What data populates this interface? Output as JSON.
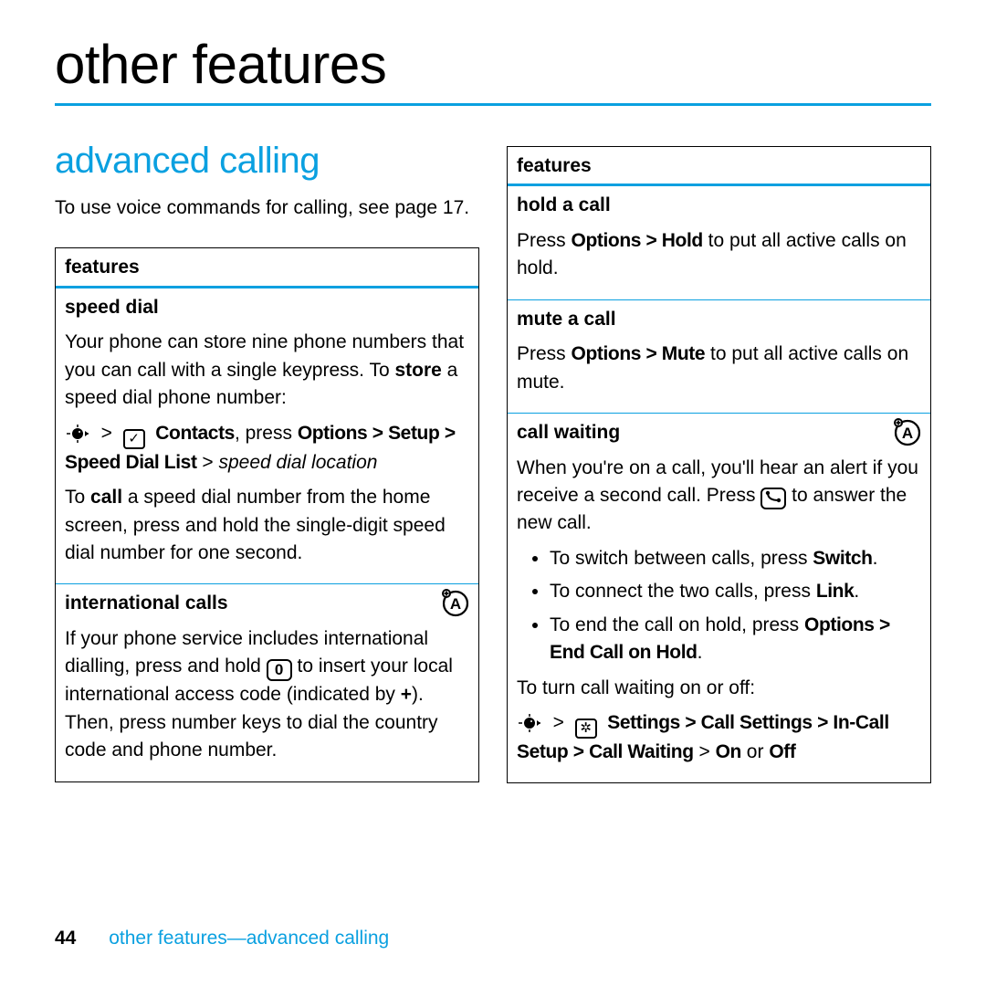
{
  "pageTitle": "other features",
  "sectionTitle": "advanced calling",
  "intro": "To use voice commands for calling, see page 17.",
  "featuresLabel": "features",
  "leftBox": {
    "speedDial": {
      "name": "speed dial",
      "p1a": "Your phone can store nine phone numbers that you can call with a single keypress. To ",
      "p1bold": "store",
      "p1b": " a speed dial phone number:",
      "path1a": "Contacts",
      "path1mid": ", press ",
      "path1b": "Options > Setup > Speed Dial List",
      "path1c": " > ",
      "path1italic": "speed dial location",
      "p2a": "To ",
      "p2bold": "call",
      "p2b": " a speed dial number from the home screen, press and hold the single-digit speed dial number for one second."
    },
    "intl": {
      "name": "international calls",
      "p1a": "If your phone service includes international dialling, press and hold ",
      "key0": "0",
      "p1b": " to insert your local international access code (indicated by ",
      "plus": "+",
      "p1c": "). Then, press number keys to dial the country code and phone number."
    }
  },
  "rightBox": {
    "hold": {
      "name": "hold a call",
      "pa": "Press ",
      "path": "Options > Hold",
      "pb": " to put all active calls on hold."
    },
    "mute": {
      "name": "mute a call",
      "pa": "Press ",
      "path": "Options > Mute",
      "pb": " to put all active calls on mute."
    },
    "cw": {
      "name": "call waiting",
      "p1a": "When you're on a call, you'll hear an alert if you receive a second call. Press ",
      "p1b": " to answer the new call.",
      "li1a": "To switch between calls, press ",
      "li1b": "Switch",
      "li1c": ".",
      "li2a": "To connect the two calls, press ",
      "li2b": "Link",
      "li2c": ".",
      "li3a": "To end the call on hold, press ",
      "li3b": "Options > End Call on Hold",
      "li3c": ".",
      "p2": "To turn call waiting on or off:",
      "path2a": "Settings > Call Settings > In-Call Setup > Call Waiting",
      "path2b": " > ",
      "on": "On",
      "or": " or ",
      "off": "Off"
    }
  },
  "footer": {
    "pageNum": "44",
    "crumb": "other features—advanced calling"
  }
}
